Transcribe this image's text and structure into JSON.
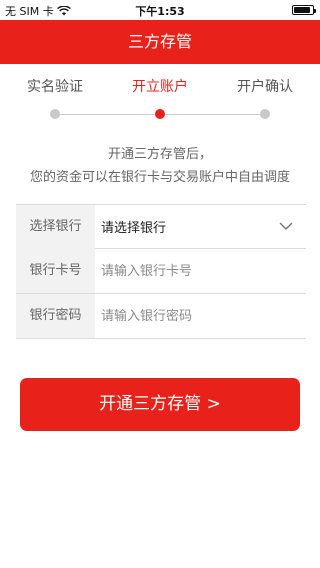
{
  "status_bar": {
    "carrier": "无 SIM 卡",
    "time": "下午1:53",
    "battery_level": 0.9
  },
  "nav": {
    "title": "三方存管"
  },
  "steps": [
    {
      "label": "实名验证",
      "active": false
    },
    {
      "label": "开立账户",
      "active": true
    },
    {
      "label": "开户确认",
      "active": false
    }
  ],
  "description": {
    "line1": "开通三方存管后，",
    "line2": "您的资金可以在银行卡与交易账户中自由调度"
  },
  "form": {
    "bank": {
      "label": "选择银行",
      "value": "请选择银行"
    },
    "card": {
      "label": "银行卡号",
      "placeholder": "请输入银行卡号"
    },
    "password": {
      "label": "银行密码",
      "placeholder": "请输入银行密码"
    }
  },
  "submit": {
    "label": "开通三方存管 >"
  },
  "colors": {
    "accent": "#e8221b",
    "inactive_dot": "#c9c9c9"
  }
}
